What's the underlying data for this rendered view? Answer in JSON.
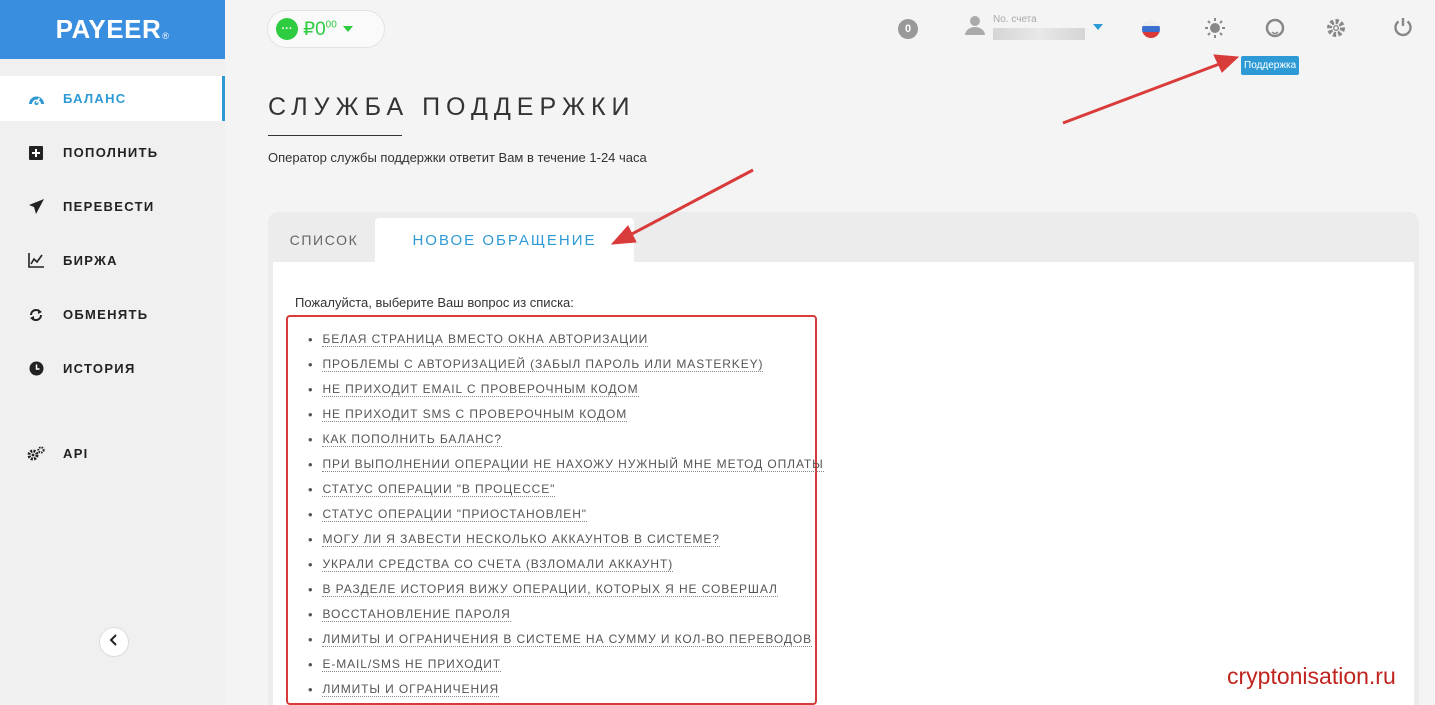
{
  "brand": {
    "logo": "PAYEER",
    "logo_mark": "®"
  },
  "sidebar": {
    "items": [
      {
        "label": "БАЛАНС",
        "icon": "gauge-icon",
        "active": true
      },
      {
        "label": "ПОПОЛНИТЬ",
        "icon": "plus-square-icon"
      },
      {
        "label": "ПЕРЕВЕСТИ",
        "icon": "paper-plane-icon"
      },
      {
        "label": "БИРЖА",
        "icon": "chart-line-icon"
      },
      {
        "label": "ОБМЕНЯТЬ",
        "icon": "exchange-icon"
      },
      {
        "label": "ИСТОРИЯ",
        "icon": "clock-icon"
      },
      {
        "label": "API",
        "icon": "gears-icon"
      }
    ],
    "collapse_icon": "chevron-left-icon"
  },
  "header": {
    "balance_currency": "₽",
    "balance_value": "0",
    "balance_cents": "00",
    "balance_status": "···",
    "notifications": "0",
    "account_label": "No. счета",
    "tooltip": "Поддержка"
  },
  "main": {
    "title": "СЛУЖБА ПОДДЕРЖКИ",
    "subtitle": "Оператор службы поддержки ответит Вам в течение 1-24 часа",
    "tabs": [
      {
        "label": "СПИСОК",
        "active": false
      },
      {
        "label": "НОВОЕ ОБРАЩЕНИЕ",
        "active": true
      }
    ],
    "prompt": "Пожалуйста, выберите Ваш вопрос из списка:",
    "questions": [
      "БЕЛАЯ СТРАНИЦА ВМЕСТО ОКНА АВТОРИЗАЦИИ",
      "ПРОБЛЕМЫ С АВТОРИЗАЦИЕЙ (ЗАБЫЛ ПАРОЛЬ ИЛИ MASTERKEY)",
      "НЕ ПРИХОДИТ EMAIL С ПРОВЕРОЧНЫМ КОДОМ",
      "НЕ ПРИХОДИТ SMS С ПРОВЕРОЧНЫМ КОДОМ",
      "КАК ПОПОЛНИТЬ БАЛАНС?",
      "ПРИ ВЫПОЛНЕНИИ ОПЕРАЦИИ НЕ НАХОЖУ НУЖНЫЙ МНЕ МЕТОД ОПЛАТЫ",
      "СТАТУС ОПЕРАЦИИ \"В ПРОЦЕССЕ\"",
      "СТАТУС ОПЕРАЦИИ \"ПРИОСТАНОВЛЕН\"",
      "МОГУ ЛИ Я ЗАВЕСТИ НЕСКОЛЬКО АККАУНТОВ В СИСТЕМЕ?",
      "УКРАЛИ СРЕДСТВА СО СЧЕТА (ВЗЛОМАЛИ АККАУНТ)",
      "В РАЗДЕЛЕ ИСТОРИЯ ВИЖУ ОПЕРАЦИИ, КОТОРЫХ Я НЕ СОВЕРШАЛ",
      "ВОССТАНОВЛЕНИЕ ПАРОЛЯ",
      "ЛИМИТЫ И ОГРАНИЧЕНИЯ В СИСТЕМЕ НА СУММУ И КОЛ-ВО ПЕРЕВОДОВ",
      "E-MAIL/SMS НЕ ПРИХОДИТ",
      "ЛИМИТЫ И ОГРАНИЧЕНИЯ"
    ]
  },
  "watermark": "cryptonisation.ru",
  "colors": {
    "accent": "#2d9ad6",
    "brand": "#3a8ee0",
    "balance_green": "#2ecc40",
    "annotation_red": "#d93a3a"
  }
}
